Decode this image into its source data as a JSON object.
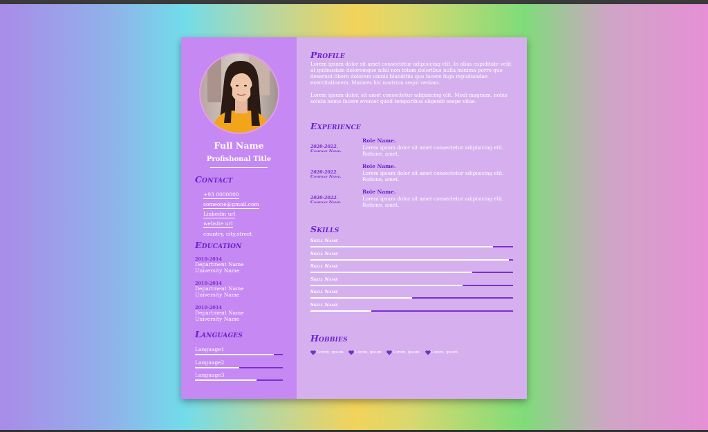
{
  "colors": {
    "left_panel": "#c688f2",
    "right_panel": "#d6b0ee",
    "accent": "#6b1fd1",
    "bar_track": "#7a2fd0",
    "bar_fill": "#ffffff"
  },
  "header": {
    "full_name": "Full Name",
    "professional_title": "Profishonal Title"
  },
  "contact": {
    "heading": "Contact",
    "phone": "+93 0000000",
    "email": "someone@gmail.com",
    "linkedin": "Linkedin url",
    "website": "website url",
    "address": "country, city,street"
  },
  "education": {
    "heading": "Education",
    "items": [
      {
        "years": "2010-2014",
        "department": "Department Name",
        "university": "University Name"
      },
      {
        "years": "2010-2014",
        "department": "Department Name",
        "university": "University Name"
      },
      {
        "years": "2010-2014",
        "department": "Department Name",
        "university": "University Name"
      }
    ]
  },
  "languages": {
    "heading": "Languages",
    "items": [
      {
        "name": "Language1",
        "level": 0.9
      },
      {
        "name": "Language2",
        "level": 0.5
      },
      {
        "name": "Language3",
        "level": 0.7
      }
    ]
  },
  "profile": {
    "heading": "Profile",
    "paragraph1": "Lorem ipsum dolor sit amet consectetur adipisicing elit. In alias cupiditate velit at quibusdam doloremque nihil non totam doloribus nulla minima porro quo deserunt libero dolorem omnis blanditiis quo facere fuga repudiandae exercitationem. Maiores hic nostrum sequi veniam.",
    "paragraph2": "Lorem ipsum dolor, sit amet consectetur adipisicing elit. Modi magnam, nobis soluta nemo facere eveniet quod temporibus eligendi saepe vitae."
  },
  "experience": {
    "heading": "Experience",
    "items": [
      {
        "date": "2020-2022.",
        "company": "Company Name.",
        "role": "Role Name.",
        "description": "Lorem ipsum dolor sit amet consectetur adipisicing elit. Ratione, amet."
      },
      {
        "date": "2020-2022.",
        "company": "Company Name.",
        "role": "Role Name.",
        "description": "Lorem ipsum dolor sit amet consectetur adipisicing elit. Ratione, amet."
      },
      {
        "date": "2020-2022.",
        "company": "Company Name.",
        "role": "Role Name.",
        "description": "Lorem ipsum dolor sit amet consectetur adipisicing elit. Ratione, amet."
      }
    ]
  },
  "skills": {
    "heading": "Skills",
    "items": [
      {
        "name": "Skill Name",
        "level": 0.9
      },
      {
        "name": "Skill Name",
        "level": 0.98
      },
      {
        "name": "Skill Name",
        "level": 0.8
      },
      {
        "name": "Skill Name",
        "level": 0.75
      },
      {
        "name": "Skill Name",
        "level": 0.5
      },
      {
        "name": "Skill Name",
        "level": 0.3
      }
    ]
  },
  "hobbies": {
    "heading": "Hobbies",
    "items": [
      "Lorem, ipsum.",
      "Lorem, ipsum.",
      "Lorem, ipsum.",
      "Lorem, ipsum."
    ],
    "icon": "heart-icon"
  }
}
